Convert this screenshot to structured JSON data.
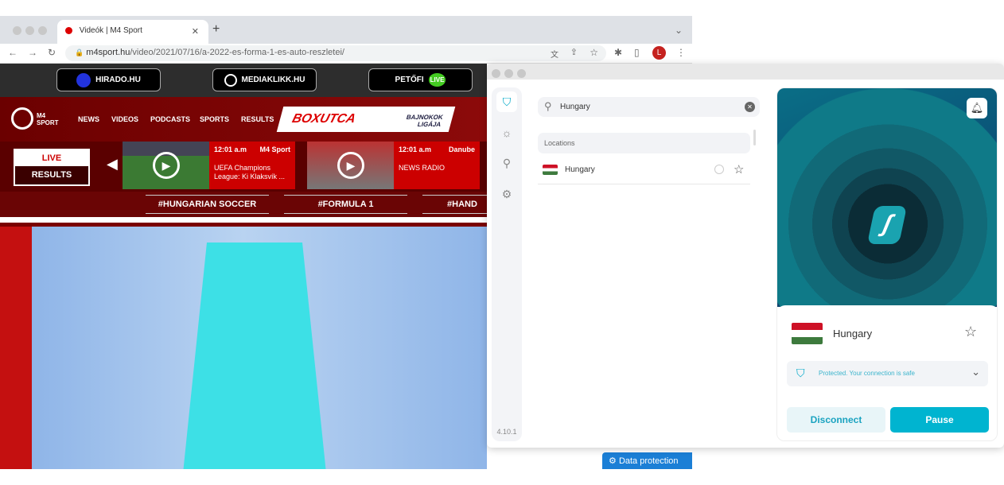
{
  "browser": {
    "tab_title": "Videók | M4 Sport",
    "url_domain": "m4sport.hu",
    "url_path": "/video/2021/07/16/a-2022-es-forma-1-es-auto-reszletei/",
    "profile_initial": "L"
  },
  "site": {
    "top_links": [
      "HIRADO.HU",
      "MEDIAKLIKK.HU",
      "PETŐFI"
    ],
    "petofi_badge": "LIVE",
    "logo": "M4 SPORT",
    "nav": [
      "NEWS",
      "VIDEOS",
      "PODCASTS",
      "SPORTS",
      "RESULTS"
    ],
    "boxutca": "BOXUTCA",
    "ucl": "BAJNOKOK LIGÁJA",
    "live": "LIVE",
    "results": "RESULTS",
    "cards": [
      {
        "time": "12:01 a.m",
        "channel": "M4 Sport",
        "title": "UEFA Champions League: Ki Klaksvík ..."
      },
      {
        "time": "12:01 a.m",
        "channel": "Danube",
        "title": "NEWS RADIO"
      }
    ],
    "hashtags": [
      "#HUNGARIAN SOCCER",
      "#FORMULA 1",
      "#HAND"
    ],
    "data_protection": "Data protection"
  },
  "vpn": {
    "search_value": "Hungary",
    "locations_header": "Locations",
    "location": "Hungary",
    "version": "4.10.1",
    "connected_country": "Hungary",
    "status": "Protected. Your connection is safe",
    "disconnect": "Disconnect",
    "pause": "Pause",
    "accent": "#00b4d0"
  }
}
